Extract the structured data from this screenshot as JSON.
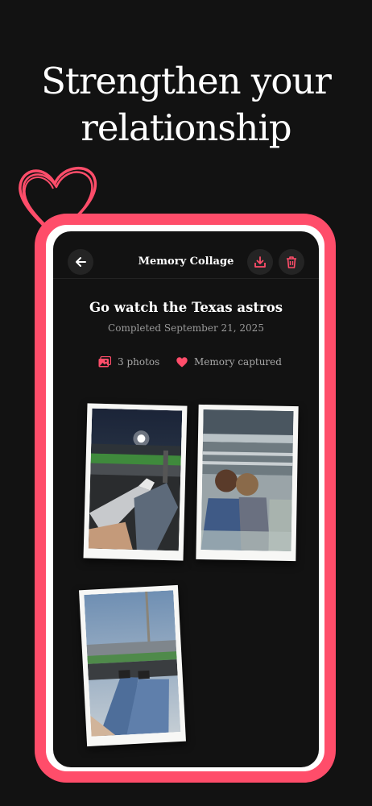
{
  "headline": {
    "line1": "Strengthen your",
    "line2": "relationship"
  },
  "topbar": {
    "title": "Memory Collage",
    "back_icon": "arrow-left-icon",
    "download_icon": "download-icon",
    "delete_icon": "trash-icon"
  },
  "memory": {
    "title": "Go watch the Texas astros",
    "completed": "Completed September 21, 2025",
    "photos_count": "3 photos",
    "memory_status": "Memory captured"
  },
  "photos": [
    {
      "alt": "stadium-night-legs-photo"
    },
    {
      "alt": "couple-kissing-stadium-photo"
    },
    {
      "alt": "stadium-day-legs-photo"
    }
  ],
  "colors": {
    "accent": "#ff4d6a",
    "background": "#121212",
    "frame_inner": "#ffffff"
  }
}
